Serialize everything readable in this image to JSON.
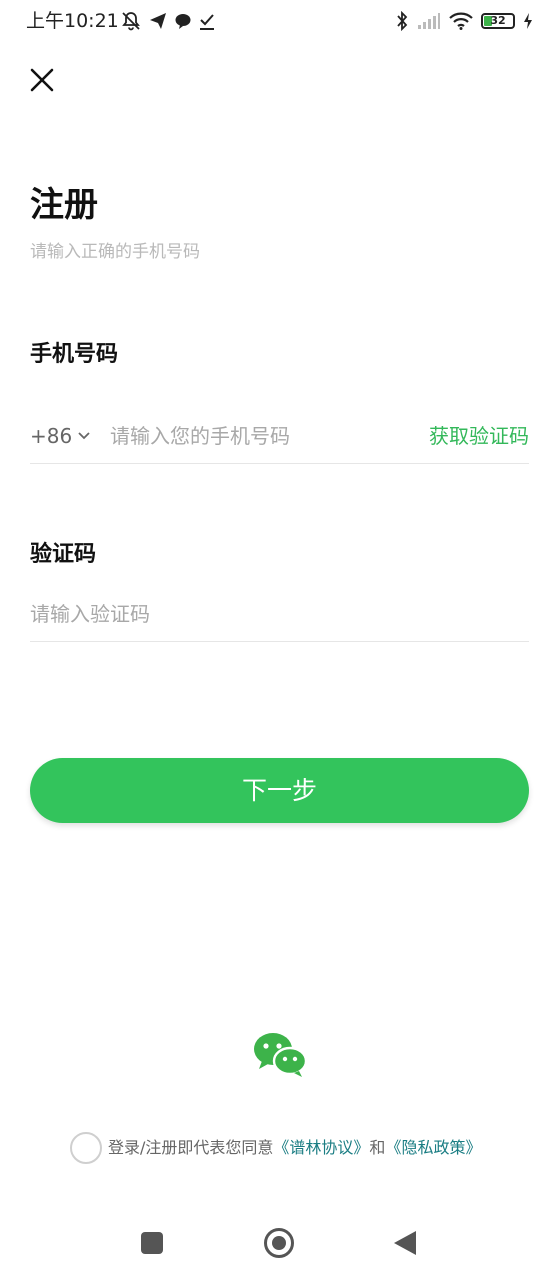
{
  "status_bar": {
    "time": "上午10:21",
    "battery": "32",
    "icons_left": [
      "mute-bell-icon",
      "send-icon",
      "chat-bubble-icon",
      "download-check-icon"
    ],
    "icons_right": [
      "bluetooth-icon",
      "signal-icon",
      "wifi-icon",
      "battery-icon",
      "charging-icon"
    ]
  },
  "header": {
    "close_icon": "close-icon"
  },
  "main": {
    "title": "注册",
    "subtitle": "请输入正确的手机号码",
    "phone": {
      "label": "手机号码",
      "country_code": "+86",
      "placeholder": "请输入您的手机号码",
      "get_code_label": "获取验证码"
    },
    "code": {
      "label": "验证码",
      "placeholder": "请输入验证码"
    },
    "next_label": "下一步"
  },
  "footer": {
    "wechat_icon": "wechat-icon",
    "agree_text_1": "登录/注册即代表您同意",
    "agreement_link": "《谱林协议》",
    "agree_and": "和",
    "privacy_link": "《隐私政策》"
  },
  "colors": {
    "accent": "#33c45c",
    "link": "#1a7d83",
    "get_code": "#33b85a"
  },
  "nav": [
    "recents-button",
    "home-button",
    "back-button"
  ]
}
